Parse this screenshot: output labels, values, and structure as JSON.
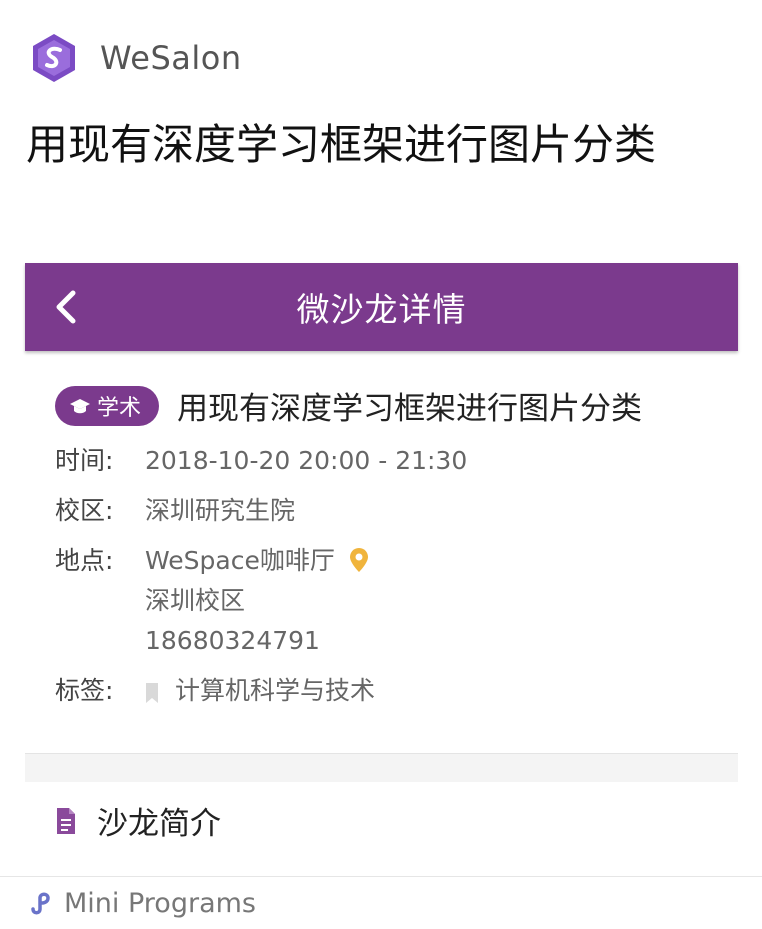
{
  "brand": {
    "name": "WeSalon",
    "logo_icon": "wesalon-logo-icon"
  },
  "article": {
    "title": "用现有深度学习框架进行图片分类"
  },
  "navbar": {
    "title": "微沙龙详情",
    "back_icon": "chevron-left-icon",
    "background": "#7b3a8d"
  },
  "salon": {
    "badge": {
      "label": "学术",
      "icon": "graduation-cap-icon"
    },
    "title": "用现有深度学习框架进行图片分类"
  },
  "details": {
    "time_label": "时间:",
    "time_value": "2018-10-20 20:00 - 21:30",
    "campus_label": "校区:",
    "campus_value": "深圳研究生院",
    "location_label": "地点:",
    "location_lines": [
      "WeSpace咖啡厅",
      "深圳校区",
      "18680324791"
    ],
    "location_icon": "map-pin-icon",
    "tag_label": "标签:",
    "tag_value": "计算机科学与技术",
    "tag_icon": "bookmark-icon"
  },
  "intro": {
    "label": "沙龙简介",
    "icon": "document-icon"
  },
  "footer": {
    "label": "Mini Programs",
    "icon": "mini-programs-icon"
  }
}
